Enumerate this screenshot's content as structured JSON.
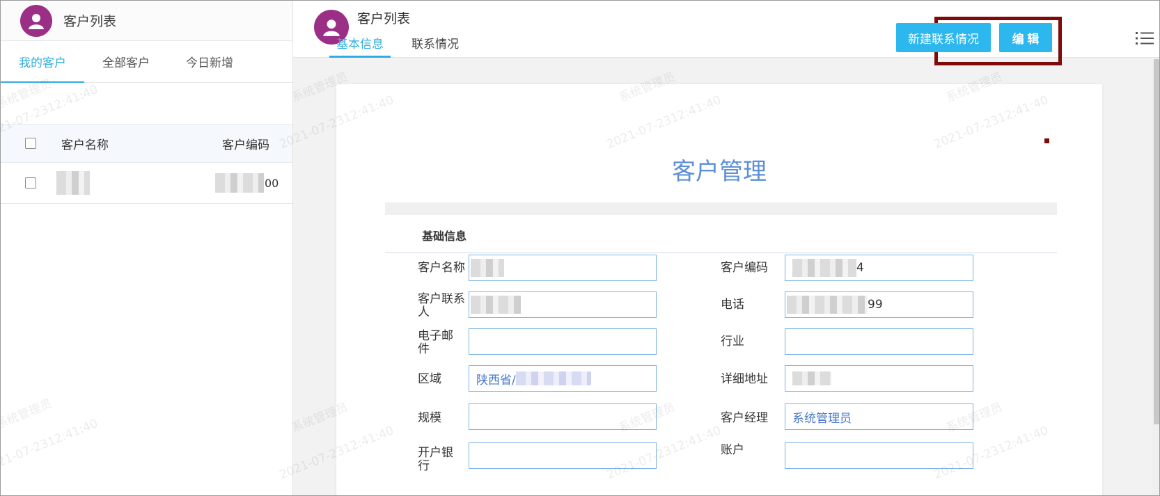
{
  "left_panel": {
    "title": "客户列表",
    "tabs": [
      {
        "label": "我的客户",
        "active": true
      },
      {
        "label": "全部客户",
        "active": false
      },
      {
        "label": "今日新增",
        "active": false
      }
    ],
    "table": {
      "columns": [
        "客户名称",
        "客户编码"
      ],
      "rows": [
        {
          "name": "",
          "code_suffix": "00"
        }
      ]
    }
  },
  "right_panel": {
    "title": "客户列表",
    "tabs": [
      {
        "label": "基本信息",
        "active": true
      },
      {
        "label": "联系情况",
        "active": false
      }
    ],
    "buttons": {
      "new_contact": "新建联系情况",
      "edit": "编 辑"
    },
    "document": {
      "title": "客户管理",
      "section": "基础信息",
      "fields": {
        "customer_name": {
          "label": "客户名称",
          "value": ""
        },
        "customer_code": {
          "label": "客户编码",
          "value": "4"
        },
        "contact_person": {
          "label": "客户联系人",
          "value": ""
        },
        "phone": {
          "label": "电话",
          "value": "99"
        },
        "email": {
          "label": "电子邮件",
          "value": ""
        },
        "industry": {
          "label": "行业",
          "value": ""
        },
        "region": {
          "label": "区域",
          "value": "陕西省/"
        },
        "address": {
          "label": "详细地址",
          "value": ""
        },
        "scale": {
          "label": "规模",
          "value": ""
        },
        "manager": {
          "label": "客户经理",
          "value": "系统管理员"
        },
        "bank": {
          "label": "开户银行",
          "value": ""
        },
        "account": {
          "label": "账户",
          "value": ""
        }
      }
    }
  },
  "watermark": {
    "user": "系统管理员",
    "time": "2021-07-2312:41:40"
  },
  "colors": {
    "accent": "#2eaee0",
    "button": "#2db7ef",
    "highlight": "#7f0a0a",
    "avatar": "#9b2f86",
    "title": "#5d8fd8"
  },
  "icons": [
    "user-avatar-icon",
    "list-menu-icon"
  ]
}
